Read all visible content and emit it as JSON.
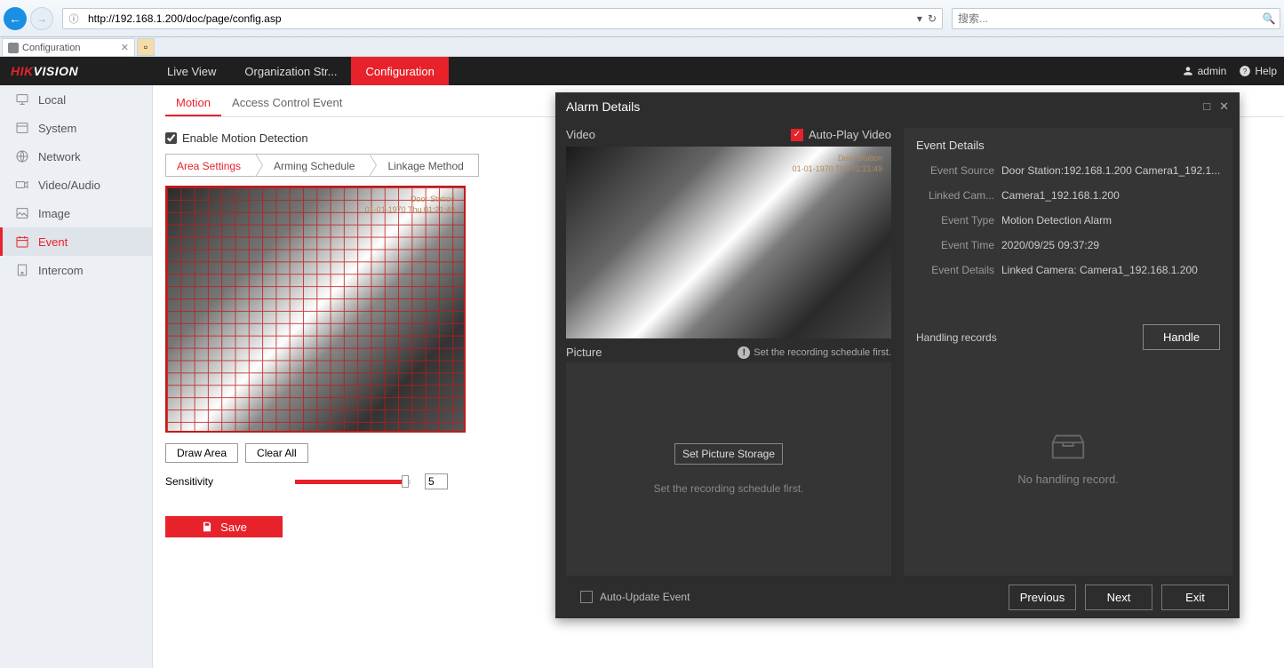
{
  "browser": {
    "url": "http://192.168.1.200/doc/page/config.asp",
    "search_placeholder": "搜索...",
    "tab_title": "Configuration"
  },
  "header": {
    "logo_prefix": "HIK",
    "logo_suffix": "VISION",
    "nav": [
      "Live View",
      "Organization Str...",
      "Configuration"
    ],
    "active_nav": "Configuration",
    "user": "admin",
    "help": "Help"
  },
  "sidebar": {
    "items": [
      "Local",
      "System",
      "Network",
      "Video/Audio",
      "Image",
      "Event",
      "Intercom"
    ],
    "active": "Event"
  },
  "sub_tabs": {
    "items": [
      "Motion",
      "Access Control Event"
    ],
    "active": "Motion"
  },
  "config": {
    "enable_label": "Enable Motion Detection",
    "enable_checked": true,
    "breadcrumbs": [
      "Area Settings",
      "Arming Schedule",
      "Linkage Method"
    ],
    "breadcrumb_active": "Area Settings",
    "osd_title": "Door Station",
    "osd_time": "01-01-1970 Thu 01:21:49",
    "draw_btn": "Draw Area",
    "clear_btn": "Clear All",
    "sensitivity_label": "Sensitivity",
    "sensitivity_value": "5",
    "save_btn": "Save"
  },
  "modal": {
    "title": "Alarm Details",
    "video_label": "Video",
    "autoplay_label": "Auto-Play Video",
    "autoplay_checked": true,
    "osd_title": "Door Station",
    "osd_time": "01-01-1970 Thu 01:21:49",
    "picture_label": "Picture",
    "schedule_warning": "Set the recording schedule first.",
    "set_storage_btn": "Set Picture Storage",
    "pic_msg": "Set the recording schedule first.",
    "details_title": "Event Details",
    "details": [
      {
        "label": "Event Source",
        "value": "Door Station:192.168.1.200 Camera1_192.1..."
      },
      {
        "label": "Linked Cam...",
        "value": "Camera1_192.168.1.200"
      },
      {
        "label": "Event Type",
        "value": "Motion Detection Alarm"
      },
      {
        "label": "Event Time",
        "value": "2020/09/25 09:37:29"
      },
      {
        "label": "Event Details",
        "value": "Linked Camera: Camera1_192.168.1.200"
      }
    ],
    "handling_label": "Handling records",
    "handle_btn": "Handle",
    "no_record": "No handling record.",
    "auto_update_label": "Auto-Update Event",
    "previous_btn": "Previous",
    "next_btn": "Next",
    "exit_btn": "Exit"
  }
}
